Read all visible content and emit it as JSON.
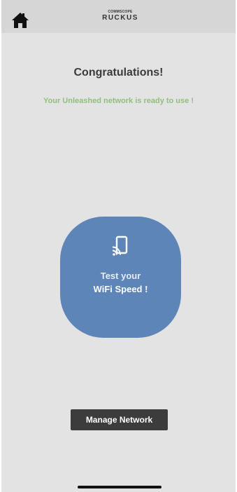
{
  "header": {
    "home_icon": "home-icon",
    "logo_small": "COMMSCOPE",
    "logo_main": "RUCKUS"
  },
  "main": {
    "title": "Congratulations!",
    "subtitle": "Your Unleashed network is ready to use !",
    "speed_test": {
      "icon": "cast-device-icon",
      "line1": "Test your",
      "line2": "WiFi Speed !"
    },
    "manage_label": "Manage Network"
  },
  "colors": {
    "background": "#e3e3e3",
    "header": "#d6d6d6",
    "accent_green": "#8fbf7f",
    "speed_button": "#5d85b8",
    "manage_button": "#3c3c3c"
  }
}
